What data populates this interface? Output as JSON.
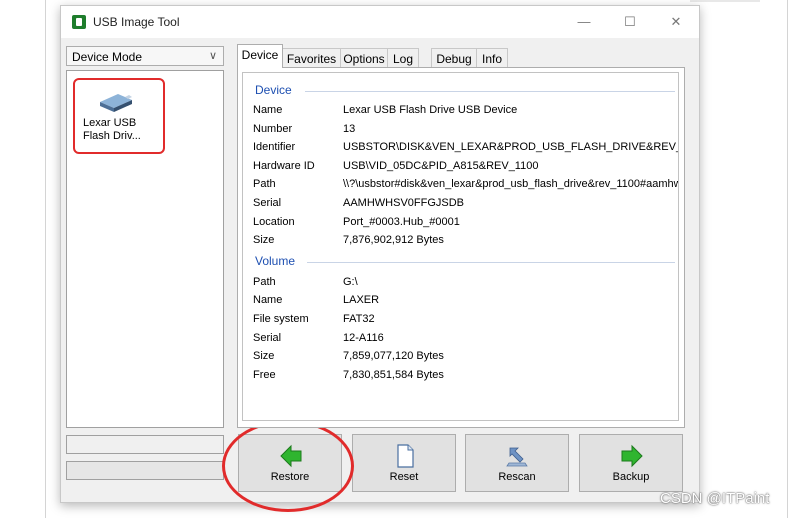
{
  "window": {
    "title": "USB Image Tool",
    "minimize_glyph": "—",
    "maximize_glyph": "☐",
    "close_glyph": "✕"
  },
  "mode_select": {
    "value": "Device Mode",
    "chevron": "∨"
  },
  "devices": [
    {
      "label": "Lexar USB Flash Driv...",
      "icon": "usb-drive-icon",
      "selected": true
    }
  ],
  "tabs": [
    {
      "label": "Device",
      "active": true
    },
    {
      "label": "Favorites"
    },
    {
      "label": "Options"
    },
    {
      "label": "Log"
    },
    {
      "label": "Debug"
    },
    {
      "label": "Info"
    }
  ],
  "device_group": {
    "title": "Device",
    "rows": [
      {
        "label": "Name",
        "value": "Lexar USB Flash Drive USB Device"
      },
      {
        "label": "Number",
        "value": "13"
      },
      {
        "label": "Identifier",
        "value": "USBSTOR\\DISK&VEN_LEXAR&PROD_USB_FLASH_DRIVE&REV_"
      },
      {
        "label": "Hardware ID",
        "value": "USB\\VID_05DC&PID_A815&REV_1100"
      },
      {
        "label": "Path",
        "value": "\\\\?\\usbstor#disk&ven_lexar&prod_usb_flash_drive&rev_1100#aamhw"
      },
      {
        "label": "Serial",
        "value": "AAMHWHSV0FFGJSDB"
      },
      {
        "label": "Location",
        "value": "Port_#0003.Hub_#0001"
      },
      {
        "label": "Size",
        "value": "7,876,902,912 Bytes"
      }
    ]
  },
  "volume_group": {
    "title": "Volume",
    "rows": [
      {
        "label": "Path",
        "value": "G:\\"
      },
      {
        "label": "Name",
        "value": "LAXER"
      },
      {
        "label": "File system",
        "value": "FAT32"
      },
      {
        "label": "Serial",
        "value": "12-A116"
      },
      {
        "label": "Size",
        "value": "7,859,077,120 Bytes"
      },
      {
        "label": "Free",
        "value": "7,830,851,584 Bytes"
      }
    ]
  },
  "buttons": {
    "restore": {
      "label": "Restore",
      "icon": "green-left-arrow-icon"
    },
    "reset": {
      "label": "Reset",
      "icon": "blank-document-icon"
    },
    "rescan": {
      "label": "Rescan",
      "icon": "rescan-icon"
    },
    "backup": {
      "label": "Backup",
      "icon": "green-right-arrow-icon"
    }
  },
  "colors": {
    "highlight_annotation": "#e12b2b",
    "group_header": "#1d4fb1",
    "arrow_green": "#2fb52f"
  },
  "watermark": "CSDN @ITPaint"
}
